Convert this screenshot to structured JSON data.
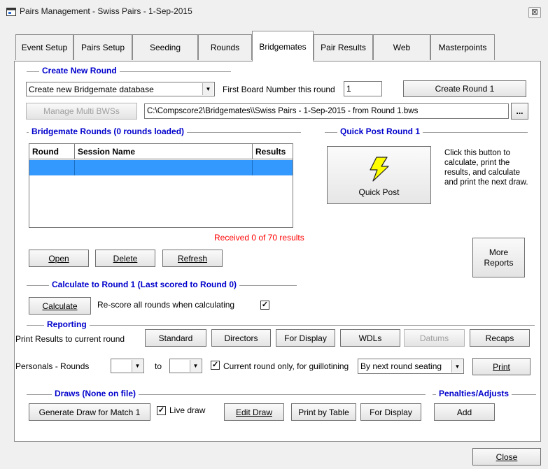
{
  "window": {
    "title": "Pairs Management - Swiss Pairs - 1-Sep-2015",
    "close_glyph": "⊠"
  },
  "tabs": [
    {
      "label": "Event Setup"
    },
    {
      "label": "Pairs Setup"
    },
    {
      "label": "Seeding"
    },
    {
      "label": "Rounds"
    },
    {
      "label": "Bridgemates"
    },
    {
      "label": "Pair Results"
    },
    {
      "label": "Web"
    },
    {
      "label": "Masterpoints"
    }
  ],
  "active_tab": "Bridgemates",
  "create_round": {
    "heading": "Create New Round",
    "db_select": "Create new Bridgemate database",
    "first_board_label": "First Board Number this round",
    "first_board_value": "1",
    "create_button": "Create Round 1",
    "manage_button": "Manage Multi BWSs",
    "path_value": "C:\\Compscore2\\Bridgemates\\\\Swiss Pairs - 1-Sep-2015 - from Round 1.bws",
    "browse_button": "..."
  },
  "rounds": {
    "heading": "Bridgemate Rounds (0 rounds loaded)",
    "columns": [
      "Round",
      "Session Name",
      "Results"
    ],
    "received": "Received 0 of 70 results",
    "open_button": "Open",
    "delete_button": "Delete",
    "refresh_button": "Refresh"
  },
  "quick_post": {
    "heading": "Quick Post Round 1",
    "button_label": "Quick Post",
    "description": "Click this button to calculate, print the results, and calculate and print the next draw."
  },
  "more_reports": {
    "label_line1": "More",
    "label_line2": "Reports"
  },
  "calculate": {
    "heading": "Calculate to Round 1 (Last scored to Round 0)",
    "button": "Calculate",
    "rescore_label": "Re-score all rounds when calculating",
    "rescore_checked": true
  },
  "reporting": {
    "heading": "Reporting",
    "print_label": "Print Results to current round",
    "buttons": {
      "standard": "Standard",
      "directors": "Directors",
      "for_display": "For Display",
      "wdls": "WDLs",
      "datums": "Datums",
      "recaps": "Recaps"
    },
    "personals_label": "Personals - Rounds",
    "from_value": "",
    "to_label": "to",
    "to_value": "",
    "current_round_label": "Current round only, for guillotining",
    "current_round_checked": true,
    "order_select": "By next round seating",
    "print_button": "Print"
  },
  "draws": {
    "heading": "Draws (None on file)",
    "generate_button": "Generate Draw for Match 1",
    "live_draw_label": "Live draw",
    "live_draw_checked": true,
    "edit_button": "Edit Draw",
    "print_table_button": "Print by Table",
    "for_display_button": "For Display"
  },
  "penalties": {
    "heading": "Penalties/Adjusts",
    "add_button": "Add"
  },
  "footer": {
    "close_button": "Close"
  },
  "colors": {
    "heading_blue": "#0000cc",
    "selected_row": "#3399ff",
    "received_red": "#ff0000",
    "bolt_yellow": "#ffff00"
  },
  "icons": {
    "app": "app-window-icon",
    "quick_post": "lightning-bolt-icon",
    "checkbox": "check-icon",
    "dropdown": "chevron-down-icon"
  }
}
